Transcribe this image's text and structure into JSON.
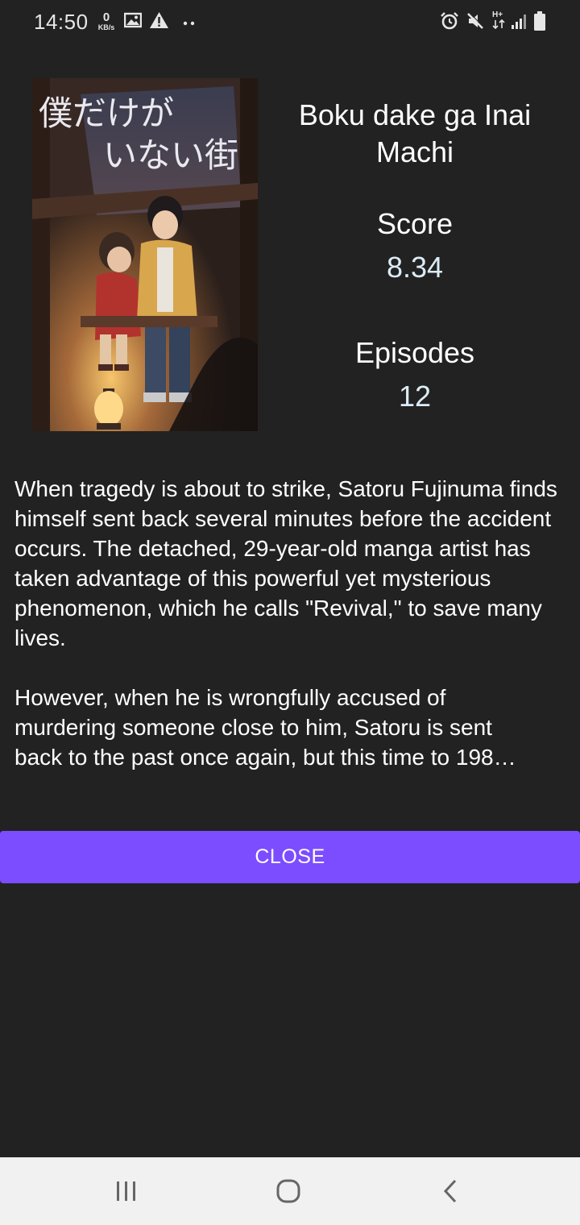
{
  "status_bar": {
    "time": "14:50",
    "net_speed_value": "0",
    "net_speed_unit": "KB/s",
    "left_icons": [
      "gallery-icon",
      "warning-icon",
      "more-dots-icon"
    ],
    "right_icons": [
      "alarm-icon",
      "mute-icon",
      "hplus-data-icon",
      "signal-icon",
      "battery-icon"
    ],
    "network_label": "H+"
  },
  "poster": {
    "title_jp_line1": "僕だけが",
    "title_jp_line2": "いない街"
  },
  "anime": {
    "title": "Boku dake ga Inai Machi",
    "score_label": "Score",
    "score_value": "8.34",
    "episodes_label": "Episodes",
    "episodes_value": "12",
    "synopsis_p1": "When tragedy is about to strike, Satoru Fujinuma finds himself sent back several minutes before the accident occurs. The detached, 29-year-old manga artist has taken advantage of this powerful yet mysterious phenomenon, which he calls \"Revival,\" to save many lives.",
    "synopsis_p2_line1": "However, when he is wrongfully accused of",
    "synopsis_p2_line2": "murdering someone close to him, Satoru is sent",
    "synopsis_p2_line3": "back to the past once again, but this time to 198…"
  },
  "actions": {
    "close_label": "CLOSE"
  },
  "colors": {
    "background": "#222222",
    "accent": "#7c4dff",
    "value_text": "#dcecf6",
    "nav_bar": "#f1f1f1"
  },
  "nav_bar": {
    "buttons": [
      "recent-apps-icon",
      "home-icon",
      "back-icon"
    ]
  }
}
